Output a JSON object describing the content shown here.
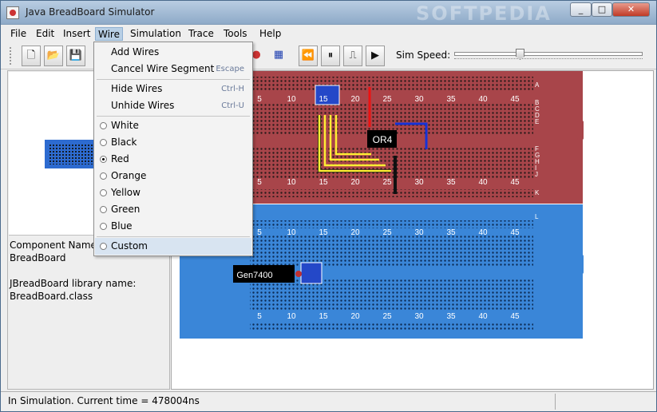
{
  "window": {
    "title": "Java BreadBoard Simulator",
    "minimize": "_",
    "maximize": "□",
    "close": "✕",
    "watermark": "SOFTPEDIA"
  },
  "menubar": [
    "File",
    "Edit",
    "Insert",
    "Wire",
    "Simulation",
    "Trace",
    "Tools",
    "Help"
  ],
  "active_menu": "Wire",
  "toolbar": {
    "sim_speed_label": "Sim Speed:",
    "sim_speed": 0.34
  },
  "wire_menu": {
    "add_wires": "Add Wires",
    "cancel_segment": "Cancel Wire Segment",
    "cancel_shortcut": "Escape",
    "hide_wires": "Hide Wires",
    "hide_shortcut": "Ctrl-H",
    "unhide_wires": "Unhide Wires",
    "unhide_shortcut": "Ctrl-U",
    "colors": [
      "White",
      "Black",
      "Red",
      "Orange",
      "Yellow",
      "Green",
      "Blue"
    ],
    "selected_color": "Red",
    "custom": "Custom"
  },
  "left_panel": {
    "component_label": "Component Name:",
    "component_value": "BreadBoard",
    "library_label": "JBreadBoard library name:",
    "library_value": "BreadBoard.class"
  },
  "board": {
    "column_numbers": [
      "5",
      "10",
      "15",
      "20",
      "25",
      "30",
      "35",
      "40",
      "45"
    ],
    "row_letters_top": [
      "A",
      "B",
      "C",
      "D",
      "E"
    ],
    "row_letters_bottom": [
      "F",
      "G",
      "H",
      "I",
      "J",
      "K",
      "L"
    ],
    "chip_top": "OR4",
    "chip_bottom": "Gen7400",
    "colors": {
      "top_board": "#a8454a",
      "bottom_board": "#3a86d8"
    }
  },
  "status": {
    "text": "In Simulation.  Current time = 478004ns"
  }
}
